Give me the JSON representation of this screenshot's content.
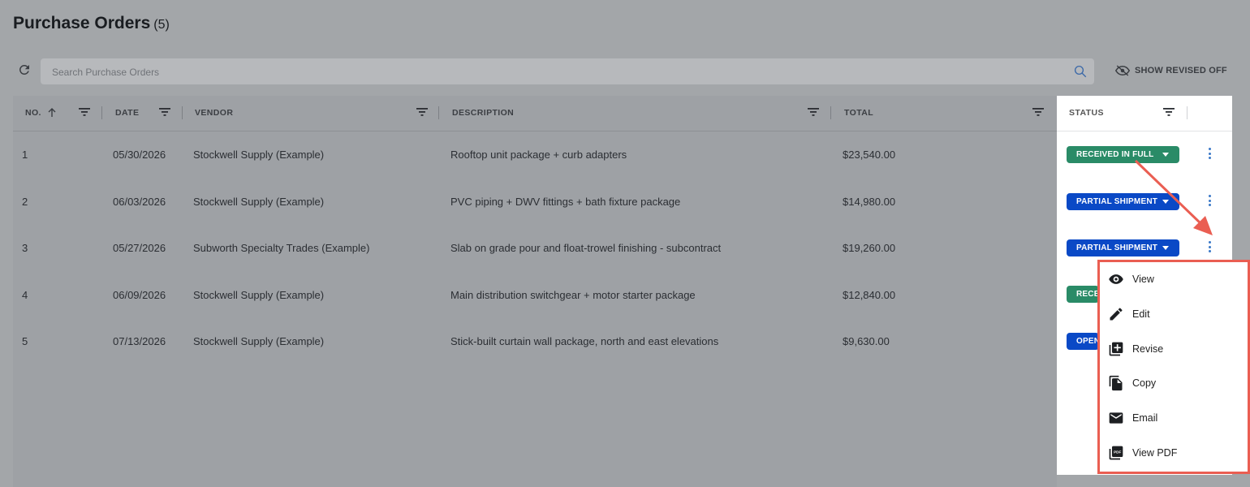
{
  "page": {
    "title": "Purchase Orders",
    "count": "(5)"
  },
  "toolbar": {
    "search_placeholder": "Search Purchase Orders",
    "show_revised": "SHOW REVISED OFF"
  },
  "columns": {
    "no": "NO.",
    "date": "DATE",
    "vendor": "VENDOR",
    "description": "DESCRIPTION",
    "total": "TOTAL",
    "status": "STATUS"
  },
  "rows": [
    {
      "no": "1",
      "date": "05/30/2026",
      "vendor": "Stockwell Supply (Example)",
      "description": "Rooftop unit package + curb adapters",
      "total": "$23,540.00",
      "status": "RECEIVED IN FULL",
      "status_color": "#2a8b67"
    },
    {
      "no": "2",
      "date": "06/03/2026",
      "vendor": "Stockwell Supply (Example)",
      "description": "PVC piping + DWV fittings + bath fixture package",
      "total": "$14,980.00",
      "status": "PARTIAL SHIPMENT",
      "status_color": "#0a49c6"
    },
    {
      "no": "3",
      "date": "05/27/2026",
      "vendor": "Subworth Specialty Trades (Example)",
      "description": "Slab on grade pour and float-trowel finishing - subcontract",
      "total": "$19,260.00",
      "status": "PARTIAL SHIPMENT",
      "status_color": "#0a49c6"
    },
    {
      "no": "4",
      "date": "06/09/2026",
      "vendor": "Stockwell Supply (Example)",
      "description": "Main distribution switchgear + motor starter package",
      "total": "$12,840.00",
      "status": "RECE",
      "status_color": "#2a8b67"
    },
    {
      "no": "5",
      "date": "07/13/2026",
      "vendor": "Stockwell Supply (Example)",
      "description": "Stick-built curtain wall package, north and east elevations",
      "total": "$9,630.00",
      "status": "OPEN",
      "status_color": "#0a49c6"
    }
  ],
  "menu": {
    "items": [
      {
        "label": "View",
        "icon": "eye-icon"
      },
      {
        "label": "Edit",
        "icon": "pencil-icon"
      },
      {
        "label": "Revise",
        "icon": "add-copy-icon"
      },
      {
        "label": "Copy",
        "icon": "copy-icon"
      },
      {
        "label": "Email",
        "icon": "envelope-icon"
      },
      {
        "label": "View PDF",
        "icon": "pdf-icon"
      }
    ]
  },
  "colors": {
    "overlay": "#a3a6a9",
    "highlight": "#ea5e52",
    "received": "#2a8b67",
    "partial": "#0a49c6"
  }
}
